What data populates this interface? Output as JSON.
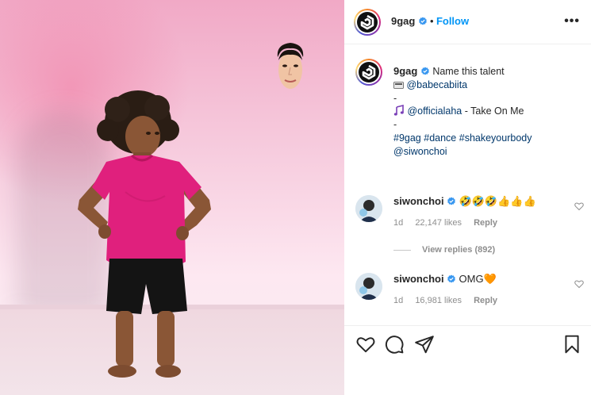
{
  "post": {
    "author": "9gag",
    "follow_label": "Follow",
    "separator": "•",
    "more_label": "•••"
  },
  "caption": {
    "author": "9gag",
    "text": "Name this talent",
    "line2_mention": "@babecabiita",
    "dash1": "-",
    "line4_mention": "@officialaha",
    "line4_text": " - Take On Me",
    "dash2": "-",
    "hashtags": [
      "#9gag",
      "#dance",
      "#shakeyourbody"
    ],
    "last_mention": "@siwonchoi"
  },
  "comments": [
    {
      "author": "siwonchoi",
      "text": "🤣🤣🤣👍👍👍",
      "age": "1d",
      "likes": "22,147 likes",
      "reply": "Reply"
    },
    {
      "author": "siwonchoi",
      "text": "OMG🧡",
      "age": "1d",
      "likes": "16,981 likes",
      "reply": "Reply"
    }
  ],
  "view_replies": "View replies (892)",
  "colors": {
    "follow": "#0095f6",
    "verified": "#3897f0",
    "link": "#00376b",
    "shirt": "#e0207d"
  },
  "icons": [
    "heart-icon",
    "comment-icon",
    "share-icon",
    "bookmark-icon",
    "verified-icon",
    "more-icon"
  ]
}
